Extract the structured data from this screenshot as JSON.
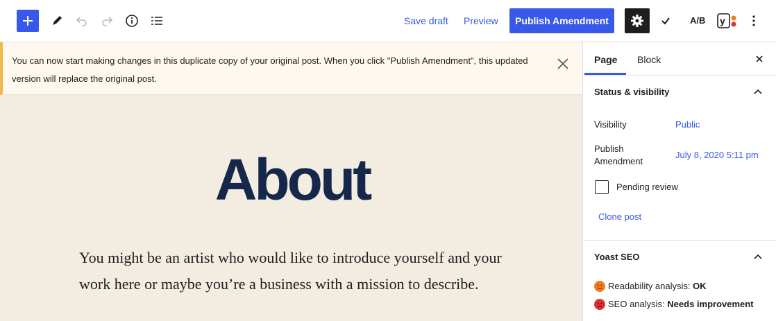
{
  "toolbar": {
    "save_draft": "Save draft",
    "preview": "Preview",
    "publish": "Publish Amendment",
    "ab_label": "A/B",
    "icons": [
      "plus-icon",
      "pencil-icon",
      "undo-icon",
      "redo-icon",
      "info-icon",
      "list-view-icon",
      "gear-icon",
      "checkmark-icon",
      "yoast-icon",
      "more-vertical-icon"
    ]
  },
  "notice": {
    "text": "You can now start making changes in this duplicate copy of your original post. When you click \"Publish Amendment\", this updated version will replace the original post."
  },
  "post": {
    "title": "About",
    "body": "You might be an artist who would like to introduce yourself and your work here or maybe you’re a business with a mission to describe."
  },
  "sidebar": {
    "tabs": [
      "Page",
      "Block"
    ],
    "status": {
      "heading": "Status & visibility",
      "visibility_label": "Visibility",
      "visibility_value": "Public",
      "publish_label": "Publish Amendment",
      "publish_value": "July 8, 2020 5:11 pm",
      "pending_label": "Pending review",
      "clone_label": "Clone post"
    },
    "yoast": {
      "heading": "Yoast SEO",
      "readability_label": "Readability analysis:",
      "readability_value": "OK",
      "seo_label": "SEO analysis:",
      "seo_value": "Needs improvement"
    }
  },
  "colors": {
    "accent": "#3858e9",
    "canvas_bg": "#f3ece0",
    "title": "#15284b",
    "notice_bg": "#fef8ee",
    "notice_border": "#f0b849",
    "ok_face": "#ee7c1b",
    "bad_face": "#dc3232"
  }
}
